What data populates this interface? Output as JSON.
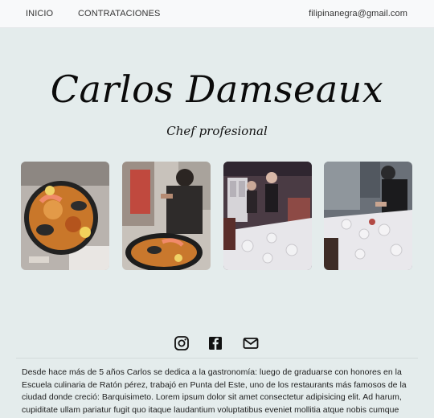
{
  "nav": {
    "inicio": "INICIO",
    "contrataciones": "CONTRATACIONES",
    "email": "filipinanegra@gmail.com"
  },
  "hero": {
    "title": "Carlos Damseaux",
    "subtitle": "Chef profesional"
  },
  "gallery": {
    "photos": [
      "paella-dish-photo",
      "chef-serving-paella-photo",
      "restaurant-staff-photo",
      "chef-at-table-photo"
    ]
  },
  "socials": {
    "icons": [
      "instagram-icon",
      "facebook-icon",
      "mail-icon"
    ]
  },
  "about": {
    "text": "Desde hace más de 5 años Carlos se dedica a la gastronomía: luego de graduarse con honores en la Escuela culinaria de Ratón pérez, trabajó en Punta del Este, uno de los restaurants más famosos de la ciudad donde creció: Barquisimeto. Lorem ipsum dolor sit amet consectetur adipisicing elit. Ad harum, cupiditate ullam pariatur fugit quo itaque laudantium voluptatibus eveniet mollitia atque nobis cumque"
  },
  "colors": {
    "background": "#e4ecec",
    "navbar": "#f8f9fa",
    "text": "#222222"
  }
}
